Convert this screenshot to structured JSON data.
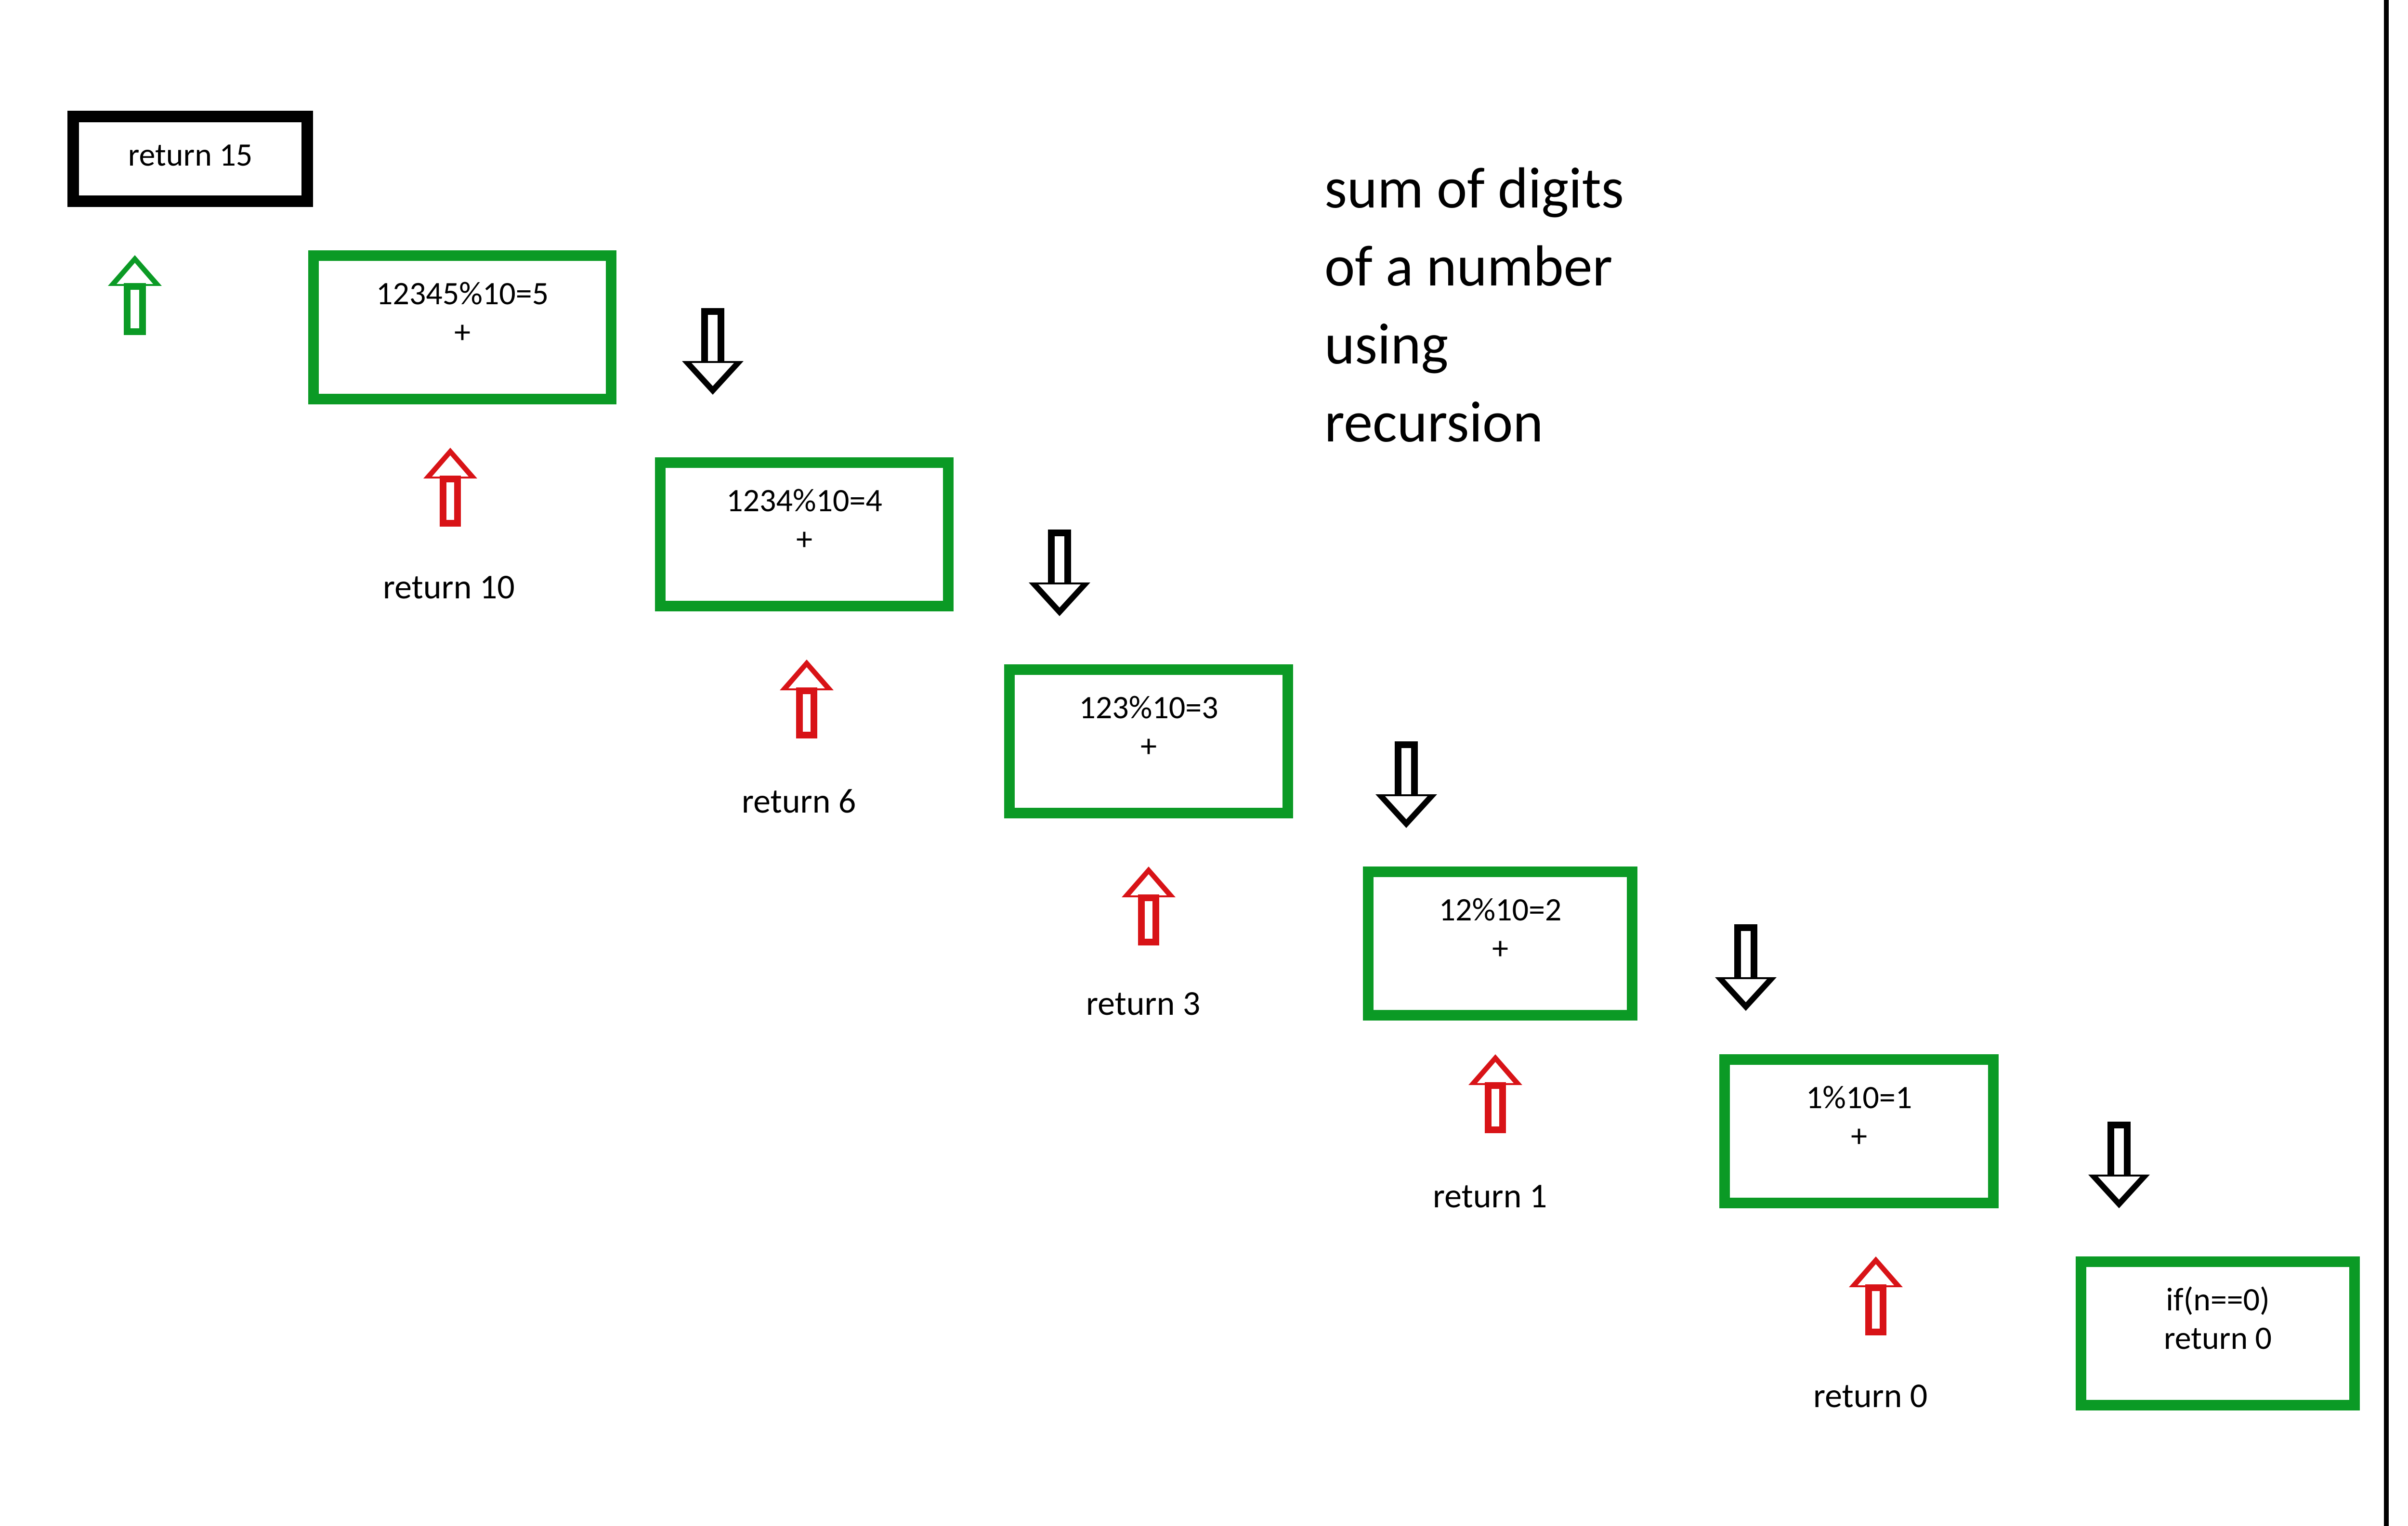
{
  "title": {
    "line1": "sum of digits",
    "line2": "of a number",
    "line3": "using",
    "line4": "recursion"
  },
  "result_box": {
    "text": "return 15"
  },
  "steps": [
    {
      "expr": "12345%10=5",
      "plus": "+",
      "ret": "return 10"
    },
    {
      "expr": "1234%10=4",
      "plus": "+",
      "ret": "return 6"
    },
    {
      "expr": "123%10=3",
      "plus": "+",
      "ret": "return 3"
    },
    {
      "expr": "12%10=2",
      "plus": "+",
      "ret": "return 1"
    },
    {
      "expr": "1%10=1",
      "plus": "+",
      "ret": "return 0"
    }
  ],
  "base_box": {
    "line1": "if(n==0)",
    "line2": "return 0"
  }
}
